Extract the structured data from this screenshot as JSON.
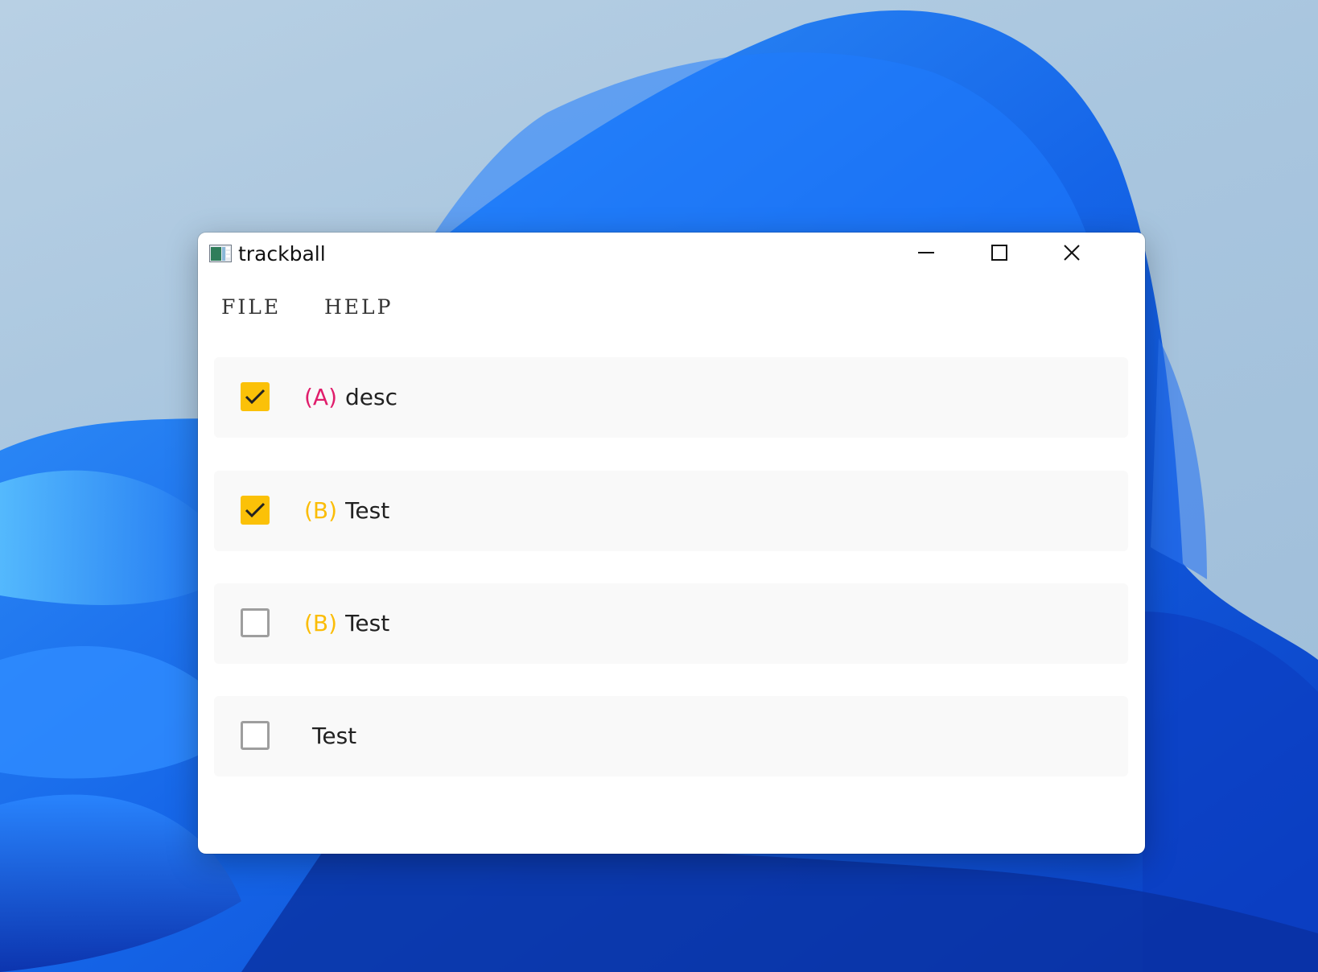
{
  "window": {
    "title": "trackball",
    "icon": "app-window-icon",
    "controls": {
      "minimize_icon": "minimize-icon",
      "maximize_icon": "maximize-icon",
      "close_icon": "close-icon"
    }
  },
  "menu": {
    "file": "FILE",
    "help": "HELP"
  },
  "tasks": [
    {
      "checked": true,
      "priority": "(A)",
      "priority_color": "#e01d6b",
      "description": "desc"
    },
    {
      "checked": true,
      "priority": "(B)",
      "priority_color": "#fbbd08",
      "description": "Test"
    },
    {
      "checked": false,
      "priority": "(B)",
      "priority_color": "#fbbd08",
      "description": "Test"
    },
    {
      "checked": false,
      "priority": "",
      "priority_color": "",
      "description": "Test"
    }
  ],
  "colors": {
    "checkbox_checked": "#fbc108",
    "checkbox_unchecked_border": "#9e9e9e",
    "row_background": "#f9f9f9"
  }
}
